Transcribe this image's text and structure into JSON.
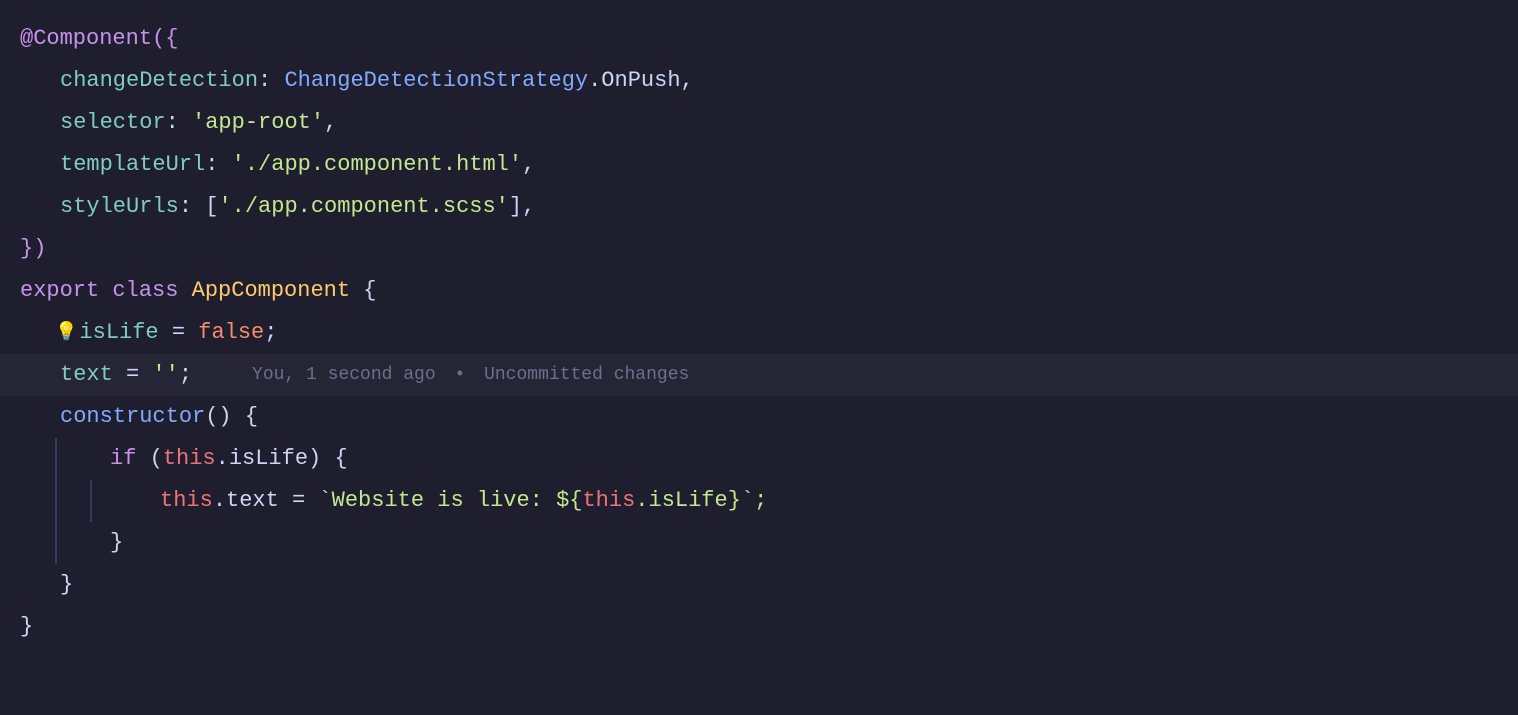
{
  "editor": {
    "background": "#1e1e2e",
    "lines": [
      {
        "id": "line-1",
        "tokens": [
          {
            "text": "@Component({",
            "classes": [
              "c-decorator"
            ]
          }
        ],
        "indent": 0
      },
      {
        "id": "line-2",
        "tokens": [
          {
            "text": "changeDetection",
            "classes": [
              "c-key"
            ]
          },
          {
            "text": ": ",
            "classes": [
              "c-colon"
            ]
          },
          {
            "text": "ChangeDetectionStrategy",
            "classes": [
              "c-class-name"
            ]
          },
          {
            "text": ".OnPush,",
            "classes": [
              "c-white"
            ]
          }
        ],
        "indent": 1
      },
      {
        "id": "line-3",
        "tokens": [
          {
            "text": "selector",
            "classes": [
              "c-key"
            ]
          },
          {
            "text": ": ",
            "classes": [
              "c-colon"
            ]
          },
          {
            "text": "'app-root'",
            "classes": [
              "c-string"
            ]
          },
          {
            "text": ",",
            "classes": [
              "c-white"
            ]
          }
        ],
        "indent": 1
      },
      {
        "id": "line-4",
        "tokens": [
          {
            "text": "templateUrl",
            "classes": [
              "c-key"
            ]
          },
          {
            "text": ": ",
            "classes": [
              "c-colon"
            ]
          },
          {
            "text": "'./app.component.html'",
            "classes": [
              "c-string"
            ]
          },
          {
            "text": ",",
            "classes": [
              "c-white"
            ]
          }
        ],
        "indent": 1
      },
      {
        "id": "line-5",
        "tokens": [
          {
            "text": "styleUrls",
            "classes": [
              "c-key"
            ]
          },
          {
            "text": ": [",
            "classes": [
              "c-white"
            ]
          },
          {
            "text": "'./app.component.scss'",
            "classes": [
              "c-string"
            ]
          },
          {
            "text": "],",
            "classes": [
              "c-white"
            ]
          }
        ],
        "indent": 1
      },
      {
        "id": "line-6",
        "tokens": [
          {
            "text": "})",
            "classes": [
              "c-brace"
            ]
          }
        ],
        "indent": 0
      },
      {
        "id": "line-7",
        "tokens": [
          {
            "text": "export ",
            "classes": [
              "c-keyword"
            ]
          },
          {
            "text": "class ",
            "classes": [
              "c-keyword"
            ]
          },
          {
            "text": "AppComponent ",
            "classes": [
              "c-class"
            ]
          },
          {
            "text": "{",
            "classes": [
              "c-white"
            ]
          }
        ],
        "indent": 0
      },
      {
        "id": "line-8",
        "tokens": [
          {
            "text": "💡",
            "classes": [
              "lightbulb-icon"
            ]
          },
          {
            "text": "isLife",
            "classes": [
              "c-property"
            ]
          },
          {
            "text": " = ",
            "classes": [
              "c-white"
            ]
          },
          {
            "text": "false",
            "classes": [
              "c-boolean"
            ]
          },
          {
            "text": ";",
            "classes": [
              "c-white"
            ]
          }
        ],
        "indent": 1,
        "hasLightbulb": true
      },
      {
        "id": "line-9",
        "tokens": [
          {
            "text": "text",
            "classes": [
              "c-property"
            ]
          },
          {
            "text": " = ",
            "classes": [
              "c-white"
            ]
          },
          {
            "text": "''",
            "classes": [
              "c-empty-string"
            ]
          },
          {
            "text": ";",
            "classes": [
              "c-white"
            ]
          }
        ],
        "indent": 1,
        "gitBlame": "You, 1 second ago • Uncommitted changes",
        "isGitBlameLine": true
      },
      {
        "id": "line-10",
        "tokens": [
          {
            "text": "constructor",
            "classes": [
              "c-constructor"
            ]
          },
          {
            "text": "() {",
            "classes": [
              "c-white"
            ]
          }
        ],
        "indent": 1
      },
      {
        "id": "line-11",
        "tokens": [
          {
            "text": "if ",
            "classes": [
              "c-if"
            ]
          },
          {
            "text": "(",
            "classes": [
              "c-white"
            ]
          },
          {
            "text": "this",
            "classes": [
              "c-this"
            ]
          },
          {
            "text": ".isLife) {",
            "classes": [
              "c-white"
            ]
          }
        ],
        "indent": 2
      },
      {
        "id": "line-12",
        "tokens": [
          {
            "text": "this",
            "classes": [
              "c-this"
            ]
          },
          {
            "text": ".text = ",
            "classes": [
              "c-white"
            ]
          },
          {
            "text": "`Website is live: ${",
            "classes": [
              "c-template"
            ]
          },
          {
            "text": "this",
            "classes": [
              "c-this"
            ]
          },
          {
            "text": ".isLife}",
            "classes": [
              "c-template"
            ]
          },
          {
            "text": "`;",
            "classes": [
              "c-template"
            ]
          }
        ],
        "indent": 3
      },
      {
        "id": "line-13",
        "tokens": [
          {
            "text": "}",
            "classes": [
              "c-white"
            ]
          }
        ],
        "indent": 2
      },
      {
        "id": "line-14",
        "tokens": [
          {
            "text": "}",
            "classes": [
              "c-white"
            ]
          }
        ],
        "indent": 1
      },
      {
        "id": "line-15",
        "tokens": [
          {
            "text": "}",
            "classes": [
              "c-white"
            ]
          }
        ],
        "indent": 0
      }
    ]
  }
}
